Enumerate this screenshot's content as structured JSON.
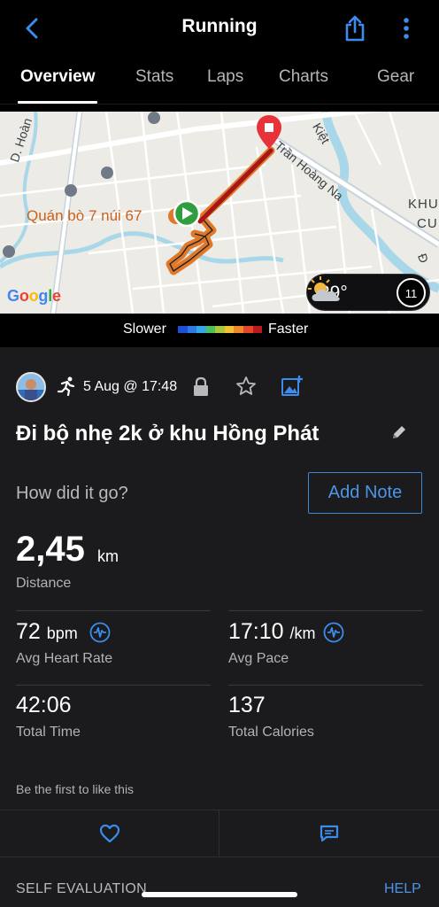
{
  "header": {
    "title": "Running"
  },
  "tabs": [
    {
      "label": "Overview",
      "active": true
    },
    {
      "label": "Stats"
    },
    {
      "label": "Laps"
    },
    {
      "label": "Charts"
    },
    {
      "label": "Gear"
    }
  ],
  "map": {
    "street_labels": [
      "D. Hoàn",
      "Trần Hoàng Na",
      "Kiệt",
      "KHU",
      "CU",
      "Đ"
    ],
    "poi_label": "Quán bò 7 núi 67",
    "attribution": "Google",
    "weather": {
      "temperature": "29°",
      "condition_icon": "partly-cloudy-icon",
      "wind": "11"
    }
  },
  "pace_legend": {
    "slower_label": "Slower",
    "faster_label": "Faster",
    "colors": [
      "#1f4fd6",
      "#2d7ae6",
      "#35a7e8",
      "#4dbf5c",
      "#a6c83a",
      "#f1c232",
      "#ef8a2a",
      "#e5462b",
      "#b81a1e"
    ]
  },
  "activity": {
    "date": "5 Aug @ 17:48",
    "title": "Đi bộ nhẹ 2k ở khu Hồng Phát",
    "prompt": "How did it go?",
    "add_note_label": "Add Note",
    "distance": {
      "value": "2,45",
      "unit": "km",
      "label": "Distance"
    },
    "stats": [
      {
        "value": "72",
        "unit": "bpm",
        "label": "Avg Heart Rate"
      },
      {
        "value": "17:10",
        "unit": "/km",
        "label": "Avg Pace"
      },
      {
        "value": "42:06",
        "unit": "",
        "label": "Total Time"
      },
      {
        "value": "137",
        "unit": "",
        "label": "Total Calories"
      }
    ],
    "like_prompt": "Be the first to like this"
  },
  "footer": {
    "self_evaluation_label": "SELF EVALUATION",
    "help_label": "HELP"
  },
  "colors": {
    "accent": "#4c95e6",
    "background": "#000000",
    "card": "#1b1b1d"
  }
}
